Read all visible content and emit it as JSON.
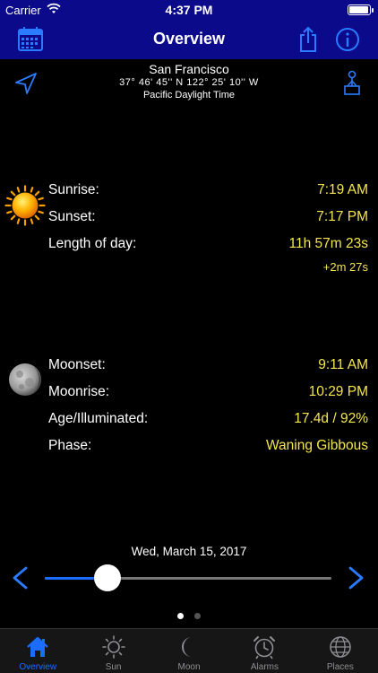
{
  "status_bar": {
    "carrier": "Carrier",
    "time": "4:37 PM",
    "battery_level": 0.95
  },
  "nav": {
    "title": "Overview"
  },
  "location": {
    "city": "San Francisco",
    "coords": "37° 46' 45'' N  122° 25' 10'' W",
    "timezone": "Pacific Daylight Time"
  },
  "sun": {
    "sunrise_label": "Sunrise:",
    "sunrise_value": "7:19 AM",
    "sunset_label": "Sunset:",
    "sunset_value": "7:17 PM",
    "length_label": "Length of day:",
    "length_value": "11h 57m 23s",
    "length_delta": "+2m 27s"
  },
  "moon": {
    "moonset_label": "Moonset:",
    "moonset_value": "9:11 AM",
    "moonrise_label": "Moonrise:",
    "moonrise_value": "10:29 PM",
    "age_label": "Age/Illuminated:",
    "age_value": "17.4d / 92%",
    "phase_label": "Phase:",
    "phase_value": "Waning Gibbous"
  },
  "date": {
    "label": "Wed, March 15, 2017",
    "slider_position": 0.22
  },
  "pages": {
    "count": 2,
    "active": 0
  },
  "tabs": [
    {
      "label": "Overview",
      "icon": "home-icon",
      "active": true
    },
    {
      "label": "Sun",
      "icon": "sun-icon",
      "active": false
    },
    {
      "label": "Moon",
      "icon": "moon-icon",
      "active": false
    },
    {
      "label": "Alarms",
      "icon": "alarm-clock-icon",
      "active": false
    },
    {
      "label": "Places",
      "icon": "globe-icon",
      "active": false
    }
  ],
  "colors": {
    "bar_blue": "#0a0a8a",
    "accent_blue": "#1a6dff",
    "value_yellow": "#f5e64e"
  }
}
